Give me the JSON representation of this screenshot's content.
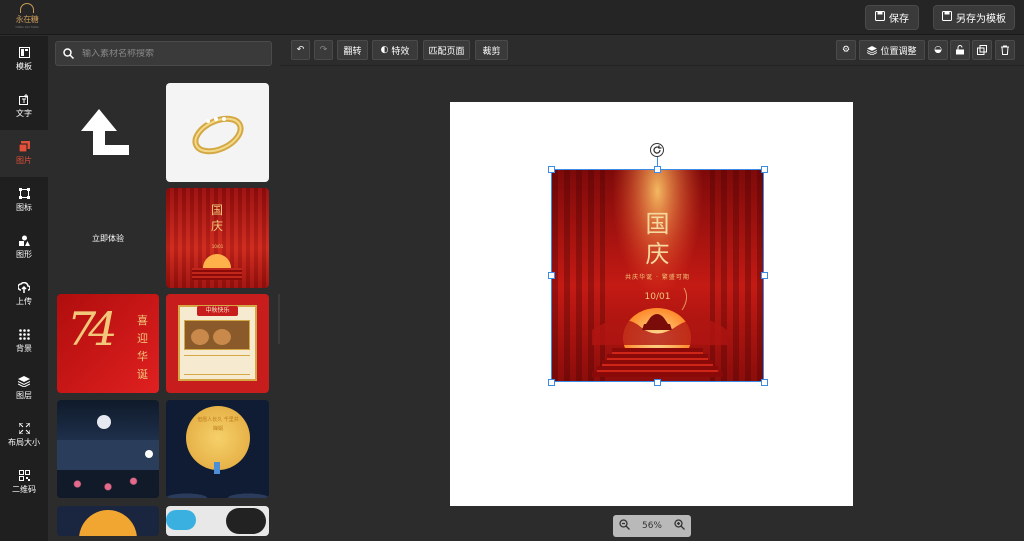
{
  "app": {
    "logo_text": "永在糖",
    "logo_sub": "YONG ZAI TANG"
  },
  "header": {
    "save_label": "保存",
    "save_template_label": "另存为模板"
  },
  "sidebar": {
    "items": [
      {
        "label": "模板",
        "icon": "template-icon"
      },
      {
        "label": "文字",
        "icon": "text-icon"
      },
      {
        "label": "图片",
        "icon": "image-icon",
        "active": true
      },
      {
        "label": "图标",
        "icon": "icon-library-icon"
      },
      {
        "label": "图形",
        "icon": "shapes-icon"
      },
      {
        "label": "上传",
        "icon": "upload-icon"
      },
      {
        "label": "背景",
        "icon": "background-icon"
      },
      {
        "label": "图层",
        "icon": "layers-icon"
      },
      {
        "label": "布局大小",
        "icon": "resize-icon"
      },
      {
        "label": "二维码",
        "icon": "qrcode-icon"
      }
    ]
  },
  "panel": {
    "search_placeholder": "输入素材名称搜索",
    "try_now_label": "立即体验",
    "thumbs": {
      "national_day": {
        "title": "国庆",
        "date": "10/01"
      },
      "seventy_four": {
        "num": "74",
        "text": "喜迎华诞"
      },
      "mooncake": {
        "title": "中秋快乐"
      },
      "moon_poem": {
        "text": "但愿人长久 千里共婵娟"
      }
    }
  },
  "toolbar": {
    "flip_label": "翻转",
    "effects_label": "特效",
    "fit_page_label": "匹配页面",
    "crop_label": "裁剪",
    "position_label": "位置调整"
  },
  "canvas": {
    "poster_title_1": "国",
    "poster_title_2": "庆",
    "poster_subtitle": "共庆华诞 · 繁盛可期",
    "poster_date": "10/01"
  },
  "zoom": {
    "level": "56%"
  },
  "colors": {
    "accent": "#e0503a",
    "selection": "#3b8ce8",
    "poster_red": "#c41a14",
    "gold": "#f3c77a"
  }
}
